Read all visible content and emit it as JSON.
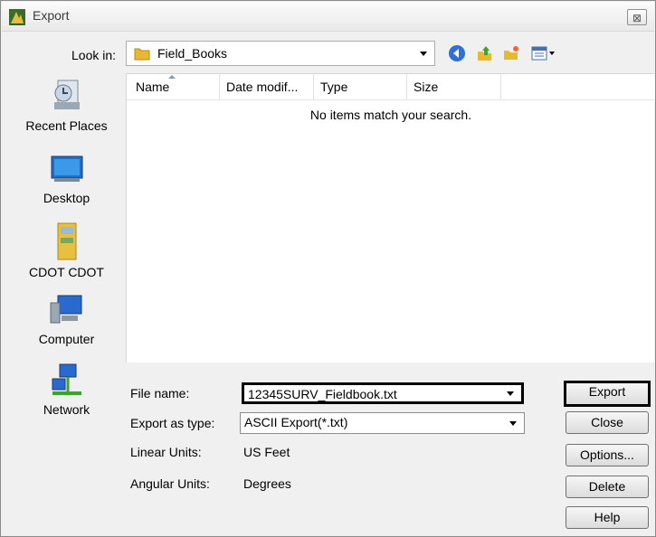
{
  "window": {
    "title": "Export",
    "close_glyph": "⊠"
  },
  "toolbar": {
    "look_in_label": "Look in:",
    "look_in_value": "Field_Books",
    "icons": [
      "back-icon",
      "up-folder-icon",
      "new-folder-icon",
      "view-menu-icon"
    ]
  },
  "places": [
    {
      "label": "Recent Places",
      "icon": "recent-places-icon"
    },
    {
      "label": "Desktop",
      "icon": "desktop-icon"
    },
    {
      "label": "CDOT CDOT",
      "icon": "user-folder-icon"
    },
    {
      "label": "Computer",
      "icon": "computer-icon"
    },
    {
      "label": "Network",
      "icon": "network-icon"
    }
  ],
  "file_list": {
    "columns": [
      "Name",
      "Date modif...",
      "Type",
      "Size"
    ],
    "empty_message": "No items match your search."
  },
  "form": {
    "file_name_label": "File name:",
    "file_name_value": "12345SURV_Fieldbook.txt",
    "export_type_label": "Export as type:",
    "export_type_value": "ASCII Export(*.txt)",
    "linear_units_label": "Linear Units:",
    "linear_units_value": "US Feet",
    "angular_units_label": "Angular Units:",
    "angular_units_value": "Degrees"
  },
  "buttons": {
    "export": "Export",
    "close": "Close",
    "options": "Options...",
    "delete": "Delete",
    "help": "Help"
  },
  "colors": {
    "dialog_bg": "#f0f0f0",
    "highlight_border": "#000000",
    "folder_yellow": "#e8b830"
  }
}
